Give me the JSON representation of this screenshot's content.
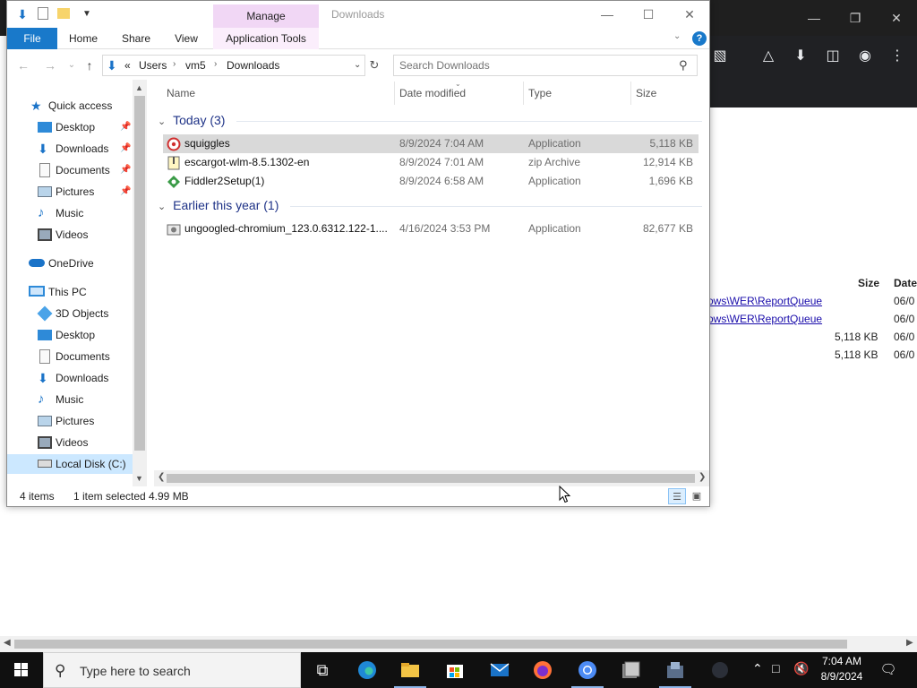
{
  "background_browser": {
    "table": {
      "headers": [
        "Size",
        "Date"
      ],
      "rows": [
        {
          "path": "ows\\WER\\ReportQueue",
          "size": "",
          "date": "06/0"
        },
        {
          "path": "ows\\WER\\ReportQueue",
          "size": "",
          "date": "06/0"
        },
        {
          "path": "",
          "size": "5,118 KB",
          "date": "06/0"
        },
        {
          "path": "",
          "size": "5,118 KB",
          "date": "06/0"
        }
      ]
    }
  },
  "explorer": {
    "title": "Downloads",
    "manage_label": "Manage",
    "ribbon_tabs": {
      "file": "File",
      "home": "Home",
      "share": "Share",
      "view": "View",
      "app_tools": "Application Tools"
    },
    "help_label": "?",
    "address": {
      "prefix": "«",
      "crumbs": [
        "Users",
        "vm5",
        "Downloads"
      ]
    },
    "search": {
      "placeholder": "Search Downloads"
    },
    "nav_pane": {
      "quick_access": "Quick access",
      "quick_items": [
        "Desktop",
        "Downloads",
        "Documents",
        "Pictures",
        "Music",
        "Videos"
      ],
      "onedrive": "OneDrive",
      "this_pc": "This PC",
      "pc_items": [
        "3D Objects",
        "Desktop",
        "Documents",
        "Downloads",
        "Music",
        "Pictures",
        "Videos",
        "Local Disk (C:)"
      ]
    },
    "columns": {
      "name": "Name",
      "date": "Date modified",
      "type": "Type",
      "size": "Size"
    },
    "groups": [
      {
        "label": "Today (3)",
        "files": [
          {
            "name": "squiggles",
            "date": "8/9/2024 7:04 AM",
            "type": "Application",
            "size": "5,118 KB",
            "selected": true
          },
          {
            "name": "escargot-wlm-8.5.1302-en",
            "date": "8/9/2024 7:01 AM",
            "type": "zip Archive",
            "size": "12,914 KB",
            "selected": false
          },
          {
            "name": "Fiddler2Setup(1)",
            "date": "8/9/2024 6:58 AM",
            "type": "Application",
            "size": "1,696 KB",
            "selected": false
          }
        ]
      },
      {
        "label": "Earlier this year (1)",
        "files": [
          {
            "name": "ungoogled-chromium_123.0.6312.122-1....",
            "date": "4/16/2024 3:53 PM",
            "type": "Application",
            "size": "82,677 KB",
            "selected": false
          }
        ]
      }
    ],
    "status": {
      "item_count": "4 items",
      "selection": "1 item selected",
      "selection_size": "4.99 MB"
    }
  },
  "taskbar": {
    "search_placeholder": "Type here to search",
    "time": "7:04 AM",
    "date": "8/9/2024"
  },
  "colors": {
    "file_tab": "#1979ca",
    "manage_tab": "#f1d7f5",
    "group_header": "#1e3287",
    "selected_row": "#d9d9d9"
  }
}
